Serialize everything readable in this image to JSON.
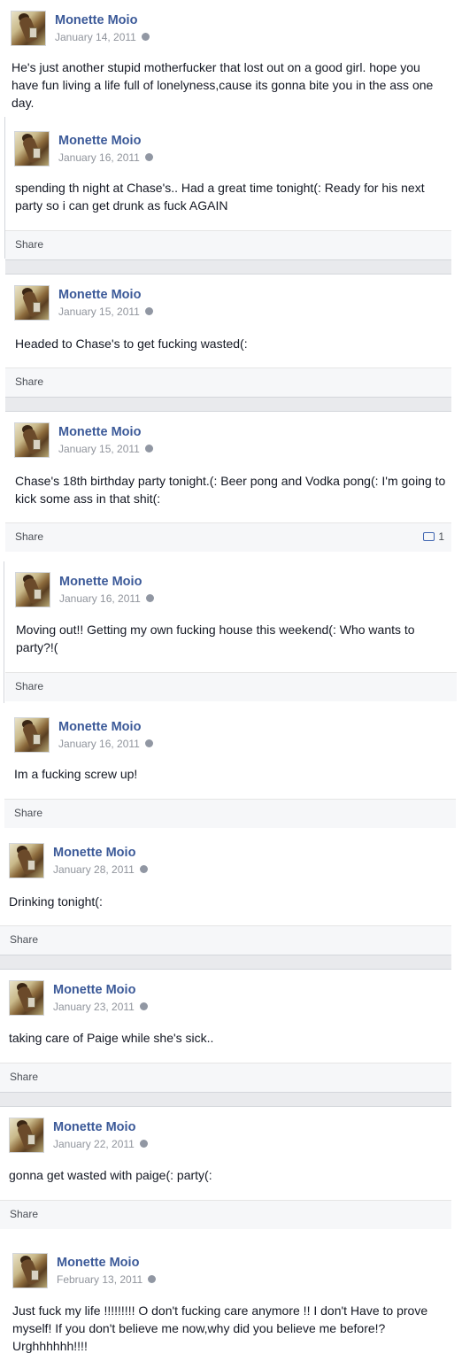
{
  "author": "Monette Moio",
  "share_label": "Share",
  "posts": [
    {
      "date": "January 14, 2011",
      "text": "He's just another stupid motherfucker that lost out on a good girl. hope you have fun living a life full of lonelyness,cause its gonna bite you in the ass one day."
    },
    {
      "date": "January 16, 2011",
      "text": "spending th night at Chase's.. Had a great time tonight(: Ready for his next party so i can get drunk as fuck AGAIN"
    },
    {
      "date": "January 15, 2011",
      "text": "Headed to Chase's to get fucking wasted(:"
    },
    {
      "date": "January 15, 2011",
      "text": "Chase's 18th birthday party tonight.(: Beer pong and Vodka pong(: I'm going to kick some ass in that shit(:",
      "comments": "1"
    },
    {
      "date": "January 16, 2011",
      "text": "Moving out!! Getting my own fucking house this weekend(: Who wants to party?!("
    },
    {
      "date": "January 16, 2011",
      "text": "Im a fucking screw up!"
    },
    {
      "date": "January 28, 2011",
      "text": "Drinking tonight(:"
    },
    {
      "date": "January 23, 2011",
      "text": "taking care of Paige while she's sick.."
    },
    {
      "date": "January 22, 2011",
      "text": "gonna get wasted with paige(: party(:"
    },
    {
      "date": "February 13, 2011",
      "text": "Just fuck my life !!!!!!!!! O don't fucking care anymore !! I don't Have to prove myself! If you don't believe me now,why did you believe me before!? Urghhhhhh!!!!"
    }
  ],
  "colors": {
    "name": "#3b5998",
    "date": "#90949c",
    "separator": "#e9eaed"
  }
}
